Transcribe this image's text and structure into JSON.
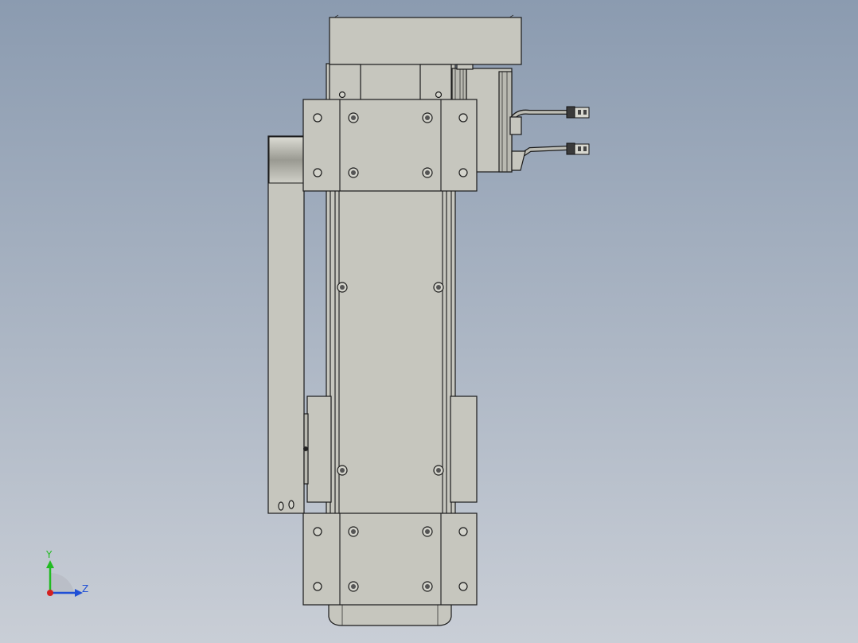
{
  "viewport": {
    "background_top": "#8b9bb0",
    "background_bottom": "#c9ced6",
    "part_color": "#c6c6be",
    "edge_color": "#1a1a1a"
  },
  "model": {
    "description_icon": "linear-actuator-front-view"
  },
  "triad": {
    "y_label": "Y",
    "z_label": "Z",
    "y_color": "#22bb22",
    "z_color": "#1f4fd6",
    "x_color": "#d42020"
  }
}
